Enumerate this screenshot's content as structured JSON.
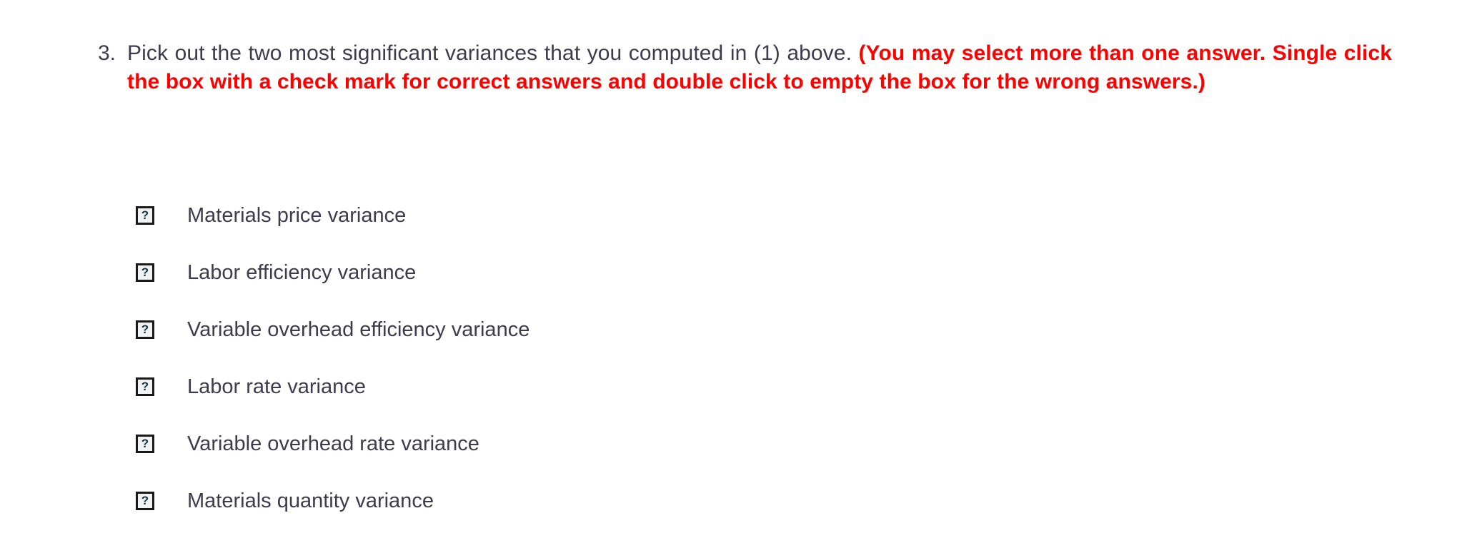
{
  "question": {
    "number": "3.",
    "prompt": "Pick out the two most significant variances that you computed in (1) above.",
    "instruction": "(You may select more than one answer. Single click the box with a check mark for correct answers and double click to empty the box for the wrong answers.)",
    "instruction_color": "#ff0000",
    "text_color": "#3c3c4c"
  },
  "options": [
    {
      "icon": "broken-image-icon",
      "label": "Materials price variance"
    },
    {
      "icon": "broken-image-icon",
      "label": "Labor efficiency variance"
    },
    {
      "icon": "broken-image-icon",
      "label": "Variable overhead efficiency variance"
    },
    {
      "icon": "broken-image-icon",
      "label": "Labor rate variance"
    },
    {
      "icon": "broken-image-icon",
      "label": "Variable overhead rate variance"
    },
    {
      "icon": "broken-image-icon",
      "label": "Materials quantity variance"
    }
  ],
  "icon_glyph": "?"
}
